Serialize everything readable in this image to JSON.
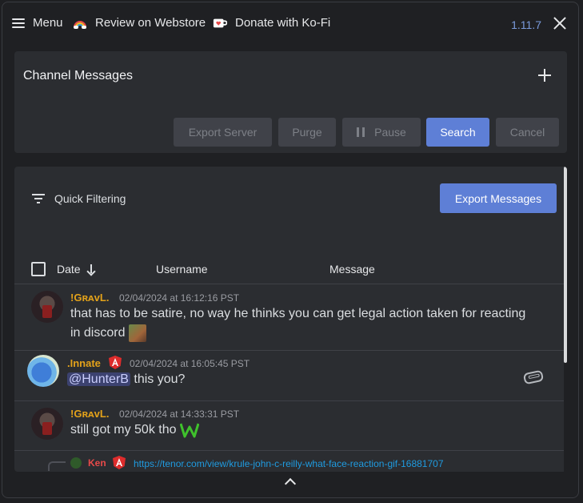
{
  "topbar": {
    "menu_label": "Menu",
    "webstore_label": "Review on Webstore",
    "kofi_label": "Donate with Ko-Fi",
    "version": "1.11.7",
    "icons": [
      "menu-icon",
      "rainbow-icon",
      "kofi-cup-icon",
      "close-icon"
    ]
  },
  "channel_panel": {
    "title": "Channel Messages",
    "buttons": {
      "export_server": "Export Server",
      "purge": "Purge",
      "pause": "Pause",
      "search": "Search",
      "cancel": "Cancel"
    }
  },
  "messages_panel": {
    "quick_filtering": "Quick Filtering",
    "export_messages": "Export Messages",
    "columns": {
      "date": "Date",
      "username": "Username",
      "message": "Message"
    },
    "messages": [
      {
        "username": "!GʀᴀᴠL.",
        "timestamp": "02/04/2024 at 16:12:16 PST",
        "text_line1": "that has to be satire, no way he thinks you can get legal action taken for reacting",
        "text_line2": "in discord"
      },
      {
        "username": ".Innate",
        "timestamp": "02/04/2024 at 16:05:45 PST",
        "mention": "@HunterB",
        "text": "this you?"
      },
      {
        "username": "!GʀᴀᴠL.",
        "timestamp": "02/04/2024 at 14:33:31 PST",
        "text": "still got my 50k tho"
      },
      {
        "username": "Ken",
        "link": "https://tenor.com/view/krule-john-c-reilly-what-face-reaction-gif-16881707"
      }
    ]
  },
  "colors": {
    "accent": "#5e7fd6",
    "username_gold": "#e3a21a",
    "username_red": "#e84a4a",
    "link": "#1f9be0",
    "background": "#1f2023",
    "panel": "#2b2d31"
  }
}
